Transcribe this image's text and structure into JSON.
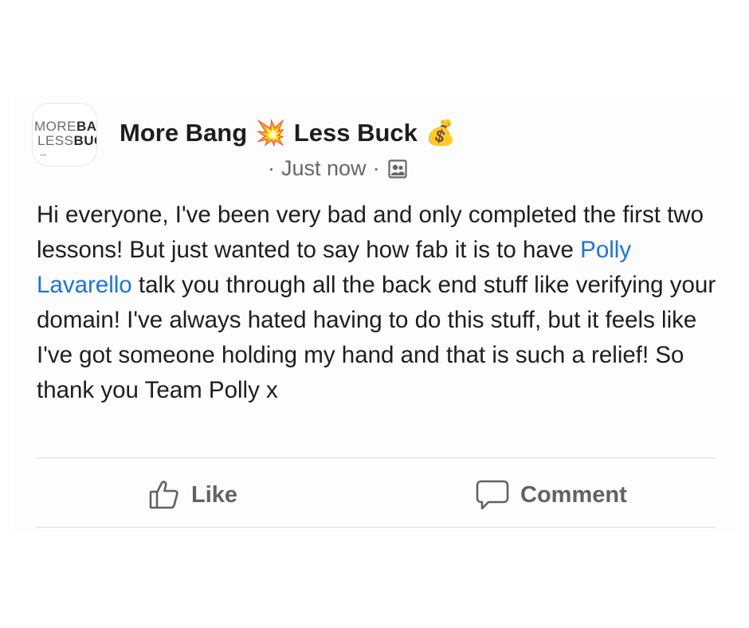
{
  "post": {
    "avatar": {
      "line1_light": "MORE",
      "line1_bold": "BAN",
      "line2_light": "LESS",
      "line2_bold": "BUC",
      "dots": "•••"
    },
    "page_name_part1": "More Bang",
    "page_name_emoji1": "💥",
    "page_name_part2": "Less Buck",
    "page_name_emoji2": "💰",
    "meta_sep1": "·",
    "timestamp": "Just now",
    "meta_sep2": "·",
    "audience_icon": "group-icon",
    "text_before_mention": "Hi everyone, I've been very bad and only completed the first two lessons! But just wanted to say how fab it is to have ",
    "mention": "Polly Lavarello",
    "text_after_mention": " talk you through all the back end stuff like verifying your domain! I've always hated having to do this stuff, but it feels like I've got someone holding my hand and that is such a relief! So thank you Team Polly x"
  },
  "actions": {
    "like_label": "Like",
    "like_icon": "thumbs-up-icon",
    "comment_label": "Comment",
    "comment_icon": "speech-bubble-icon"
  },
  "colors": {
    "text": "#1c1e21",
    "secondary": "#65676b",
    "mention": "#1b74e4",
    "action": "#606266"
  }
}
